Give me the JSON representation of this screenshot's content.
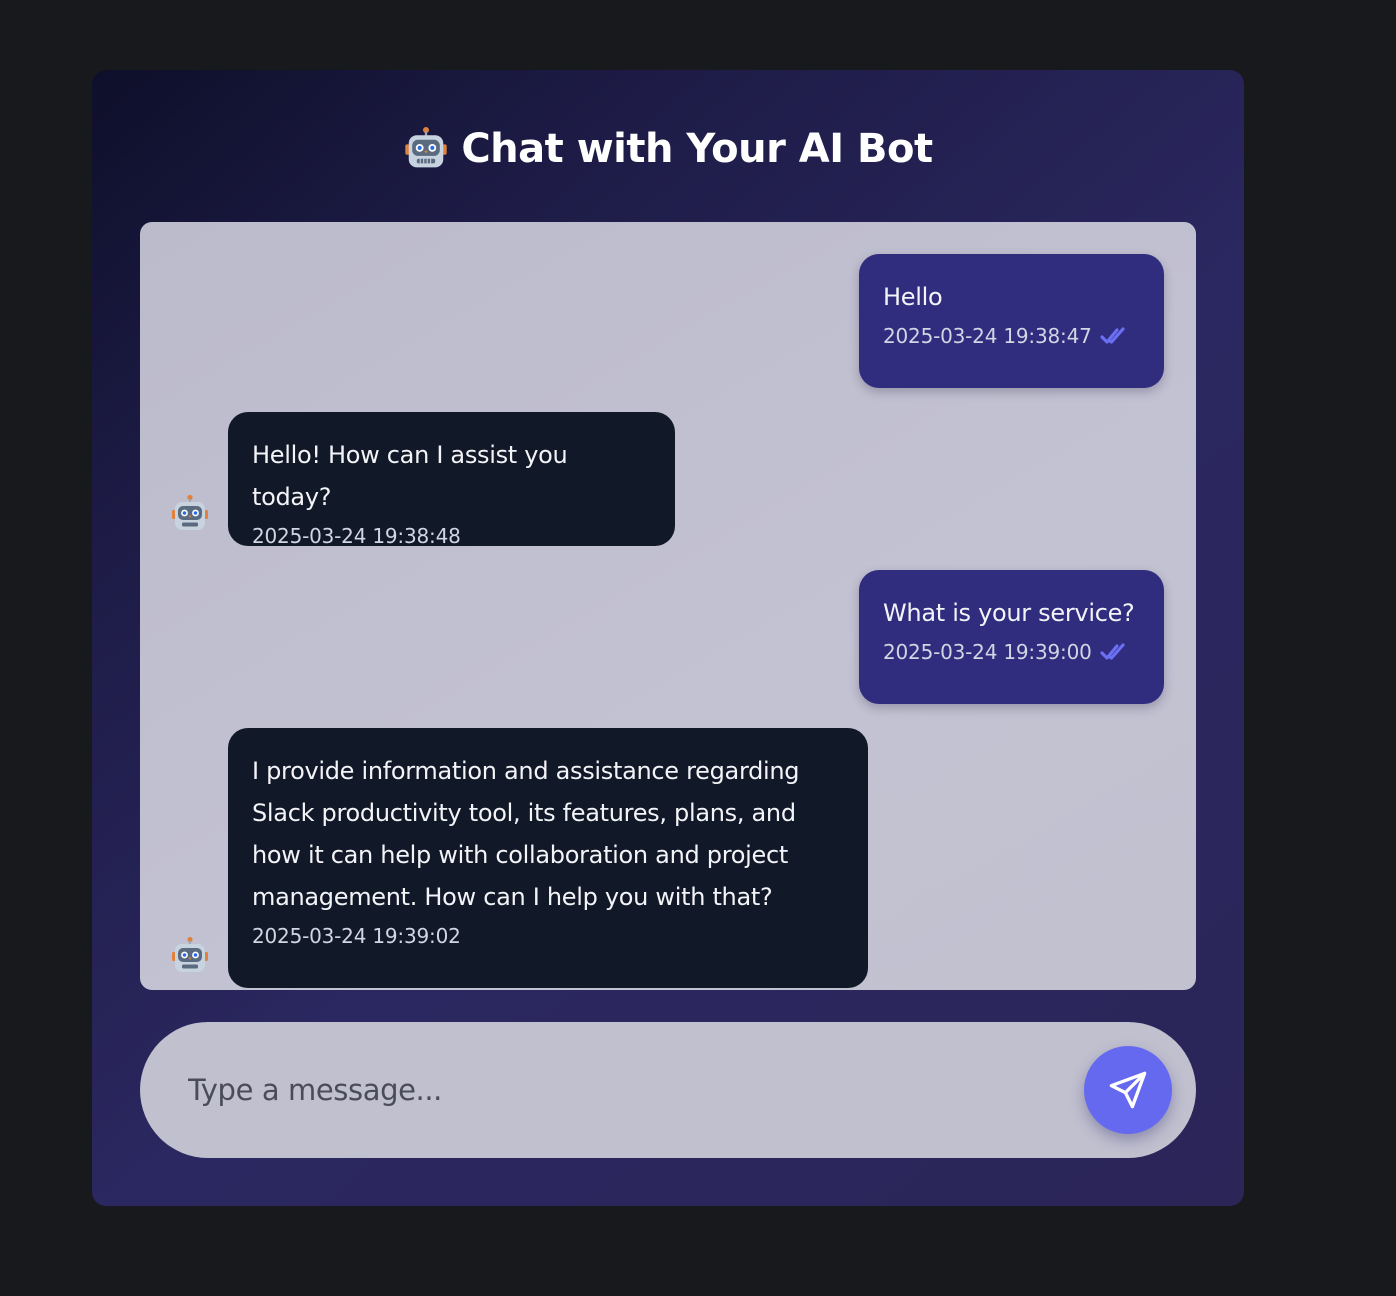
{
  "header": {
    "title": "Chat with Your AI Bot",
    "icon": "robot-icon"
  },
  "messages": [
    {
      "sender": "user",
      "text": "Hello",
      "timestamp": "2025-03-24 19:38:47",
      "status_icon": "double-check-icon"
    },
    {
      "sender": "bot",
      "text": "Hello! How can I assist you today?",
      "timestamp": "2025-03-24 19:38:48",
      "avatar_icon": "robot-icon"
    },
    {
      "sender": "user",
      "text": "What is your service?",
      "timestamp": "2025-03-24 19:39:00",
      "status_icon": "double-check-icon"
    },
    {
      "sender": "bot",
      "text_lines": [
        "I provide information and assistance regarding",
        "Slack productivity tool, its features, plans, and",
        "how it can help with collaboration and project",
        "management. How can I help you with that?"
      ],
      "timestamp": "2025-03-24 19:39:02",
      "avatar_icon": "robot-icon"
    }
  ],
  "composer": {
    "placeholder": "Type a message...",
    "send_icon": "send-icon"
  },
  "colors": {
    "page_bg": "#18191d",
    "user_bubble": "#302c7e",
    "bot_bubble": "#111827",
    "accent": "#6469ef",
    "check": "#6b6ff2"
  }
}
